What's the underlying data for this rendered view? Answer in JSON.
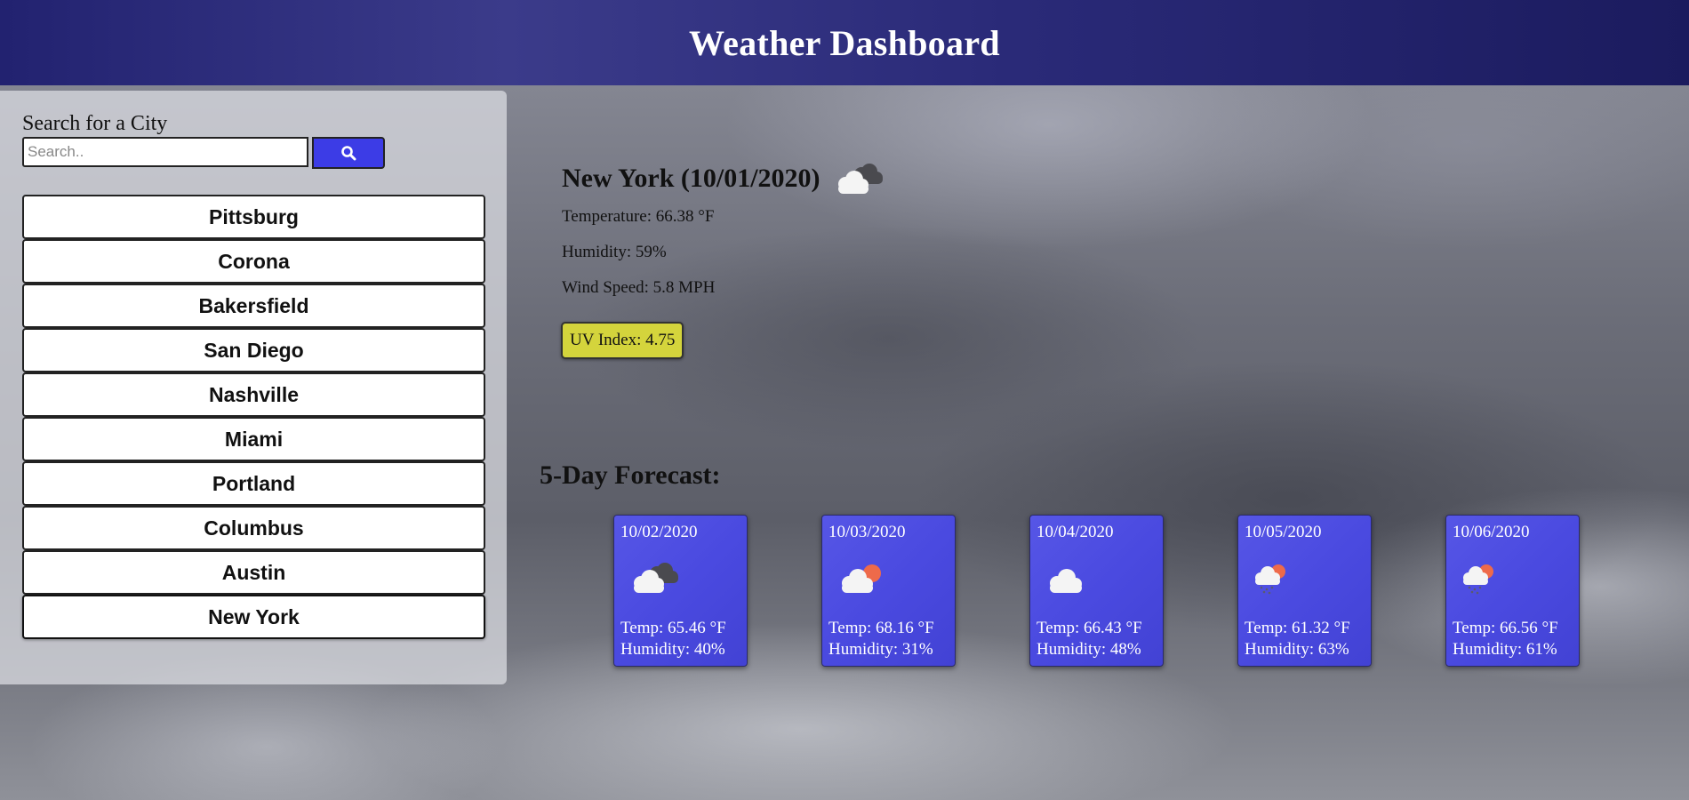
{
  "header": {
    "title": "Weather Dashboard"
  },
  "sidebar": {
    "search_label": "Search for a City",
    "search_placeholder": "Search..",
    "search_icon": "search-icon",
    "cities": [
      "Pittsburg",
      "Corona",
      "Bakersfield",
      "San Diego",
      "Nashville",
      "Miami",
      "Portland",
      "Columbus",
      "Austin",
      "New York"
    ]
  },
  "current": {
    "title": "New York (10/01/2020)",
    "icon": "broken-clouds-icon",
    "temperature": "Temperature: 66.38 °F",
    "humidity": "Humidity: 59%",
    "wind_speed": "Wind Speed: 5.8 MPH",
    "uv_index": "UV Index: 4.75"
  },
  "forecast": {
    "heading": "5-Day Forecast:",
    "days": [
      {
        "date": "10/02/2020",
        "icon": "broken-clouds-icon",
        "temp": "Temp: 65.46 °F",
        "humidity": "Humidity: 40%"
      },
      {
        "date": "10/03/2020",
        "icon": "partly-cloudy-icon",
        "temp": "Temp: 68.16 °F",
        "humidity": "Humidity: 31%"
      },
      {
        "date": "10/04/2020",
        "icon": "cloud-icon",
        "temp": "Temp: 66.43 °F",
        "humidity": "Humidity: 48%"
      },
      {
        "date": "10/05/2020",
        "icon": "light-rain-icon",
        "temp": "Temp: 61.32 °F",
        "humidity": "Humidity: 63%"
      },
      {
        "date": "10/06/2020",
        "icon": "light-rain-icon",
        "temp": "Temp: 66.56 °F",
        "humidity": "Humidity: 61%"
      }
    ]
  },
  "colors": {
    "header_bg": "#222270",
    "search_button": "#3c3ce6",
    "card_bg": "#4a4ae0",
    "uv_badge": "#d4d43c"
  }
}
